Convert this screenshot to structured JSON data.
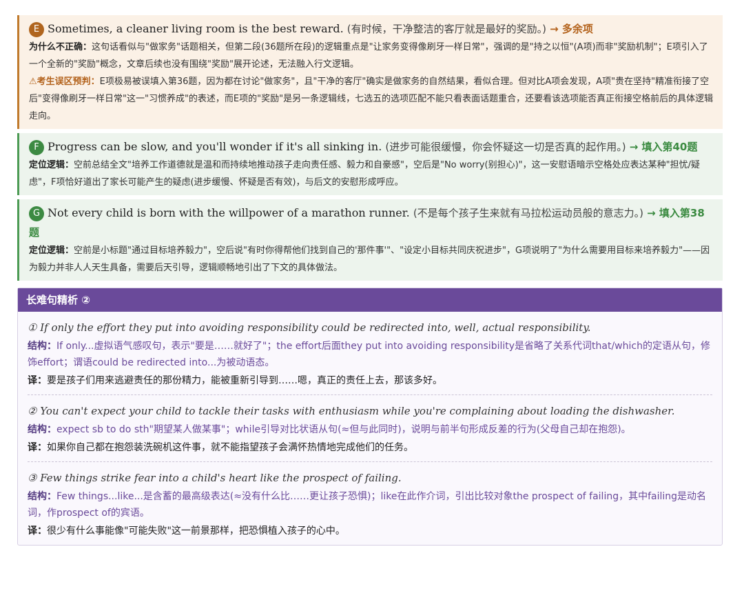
{
  "options": [
    {
      "letter": "E",
      "sentence": "Sometimes, a cleaner living room is the best reward.",
      "translation": "(有时候，干净整洁的客厅就是最好的奖励。)",
      "verdict": "→ 多余项",
      "paragraphs": [
        {
          "label": "为什么不正确：",
          "text": "这句话看似与\"做家务\"话题相关，但第二段(36题所在段)的逻辑重点是\"让家务变得像刷牙一样日常\"，强调的是\"持之以恒\"(A项)而非\"奖励机制\"；E项引入了一个全新的\"奖励\"概念，文章后续也没有围绕\"奖励\"展开论述，无法融入行文逻辑。"
        },
        {
          "label": "⚠考生误区预判：",
          "text": "E项极易被误填入第36题，因为都在讨论\"做家务\"，且\"干净的客厅\"确实是做家务的自然结果，看似合理。但对比A项会发现，A项\"贵在坚持\"精准衔接了空后\"变得像刷牙一样日常\"这一\"习惯养成\"的表述，而E项的\"奖励\"是另一条逻辑线，七选五的选项匹配不能只看表面话题重合，还要看该选项能否真正衔接空格前后的具体逻辑走向。"
        }
      ]
    },
    {
      "letter": "F",
      "sentence": "Progress can be slow, and you'll wonder if it's all sinking in.",
      "translation": "(进步可能很缓慢，你会怀疑这一切是否真的起作用。)",
      "verdict": "→ 填入第40题",
      "paragraphs": [
        {
          "label": "定位逻辑：",
          "text": "空前总结全文\"培养工作道德就是温和而持续地推动孩子走向责任感、毅力和自豪感\"，空后是\"No worry(别担心)\"，这一安慰语暗示空格处应表达某种\"担忧/疑虑\"，F项恰好道出了家长可能产生的疑虑(进步缓慢、怀疑是否有效)，与后文的安慰形成呼应。"
        }
      ]
    },
    {
      "letter": "G",
      "sentence": "Not every child is born with the willpower of a marathon runner.",
      "translation": "(不是每个孩子生来就有马拉松运动员般的意志力。)",
      "verdict": "→ 填入第38题",
      "paragraphs": [
        {
          "label": "定位逻辑：",
          "text": "空前是小标题\"通过目标培养毅力\"，空后说\"有时你得帮他们找到自己的'那件事'\"、\"设定小目标共同庆祝进步\"，G项说明了\"为什么需要用目标来培养毅力\"——因为毅力并非人人天生具备，需要后天引导，逻辑顺畅地引出了下文的具体做法。"
        }
      ]
    }
  ],
  "analysis": {
    "title": "长难句精析 ②",
    "sentences": [
      {
        "en": "① If only the effort they put into avoiding responsibility could be redirected into, well, actual responsibility.",
        "struct_label": "结构：",
        "struct": "If only...虚拟语气感叹句，表示\"要是……就好了\"；the effort后面they put into avoiding responsibility是省略了关系代词that/which的定语从句，修饰effort；谓语could be redirected into...为被动语态。",
        "trans_label": "译：",
        "trans": "要是孩子们用来逃避责任的那份精力，能被重新引导到……嗯，真正的责任上去，那该多好。"
      },
      {
        "en": "② You can't expect your child to tackle their tasks with enthusiasm while you're complaining about loading the dishwasher.",
        "struct_label": "结构：",
        "struct": "expect sb to do sth\"期望某人做某事\"；while引导对比状语从句(≈但与此同时)，说明与前半句形成反差的行为(父母自己却在抱怨)。",
        "trans_label": "译：",
        "trans": "如果你自己都在抱怨装洗碗机这件事，就不能指望孩子会满怀热情地完成他们的任务。"
      },
      {
        "en": "③ Few things strike fear into a child's heart like the prospect of failing.",
        "struct_label": "结构：",
        "struct": "Few things...like...是含蓄的最高级表达(≈没有什么比……更让孩子恐惧)；like在此作介词，引出比较对象the prospect of failing，其中failing是动名词，作prospect of的宾语。",
        "trans_label": "译：",
        "trans": "很少有什么事能像\"可能失败\"这一前景那样，把恐惧植入孩子的心中。"
      }
    ]
  }
}
